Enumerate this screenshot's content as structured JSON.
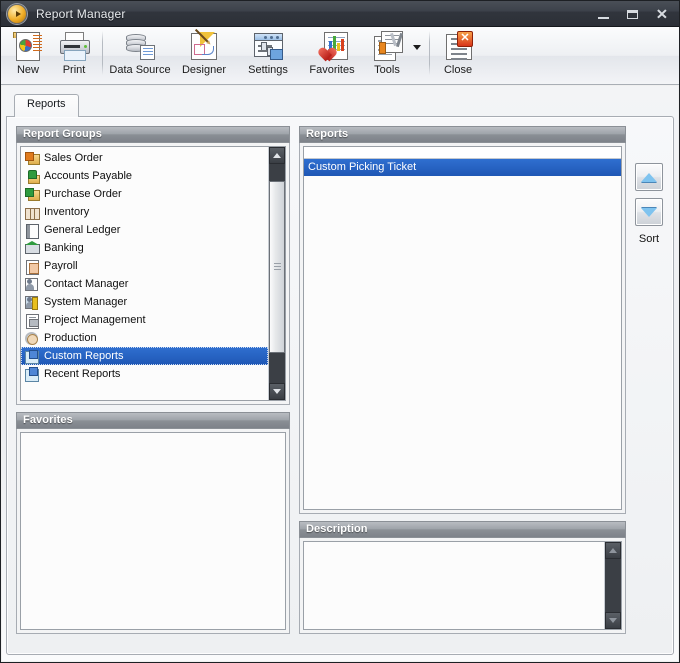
{
  "window": {
    "title": "Report Manager",
    "logo_icon": "play-circle-icon",
    "minimize_label": "–",
    "maximize_label": "□",
    "close_label": "✕"
  },
  "toolbar": {
    "items": [
      {
        "label": "New",
        "icon": "new-report-icon"
      },
      {
        "label": "Print",
        "icon": "printer-icon"
      },
      {
        "label": "Data Source",
        "icon": "database-icon"
      },
      {
        "label": "Designer",
        "icon": "designer-pencil-icon"
      },
      {
        "label": "Settings",
        "icon": "settings-sliders-icon"
      },
      {
        "label": "Favorites",
        "icon": "favorites-heart-icon"
      },
      {
        "label": "Tools",
        "icon": "tools-wrench-icon"
      },
      {
        "label": "Close",
        "icon": "close-document-icon"
      }
    ],
    "overflow_icon": "chevron-down-icon"
  },
  "tabs": [
    {
      "label": "Reports",
      "selected": true
    }
  ],
  "report_groups": {
    "title": "Report Groups",
    "items": [
      {
        "label": "Sales Order",
        "icon": "sales-order-icon",
        "selected": false
      },
      {
        "label": "Accounts Payable",
        "icon": "accounts-payable-icon",
        "selected": false
      },
      {
        "label": "Purchase Order",
        "icon": "purchase-order-icon",
        "selected": false
      },
      {
        "label": "Inventory",
        "icon": "inventory-icon",
        "selected": false
      },
      {
        "label": "General Ledger",
        "icon": "general-ledger-icon",
        "selected": false
      },
      {
        "label": "Banking",
        "icon": "banking-icon",
        "selected": false
      },
      {
        "label": "Payroll",
        "icon": "payroll-icon",
        "selected": false
      },
      {
        "label": "Contact Manager",
        "icon": "contact-manager-icon",
        "selected": false
      },
      {
        "label": "System Manager",
        "icon": "system-manager-icon",
        "selected": false
      },
      {
        "label": "Project Management",
        "icon": "project-management-icon",
        "selected": false
      },
      {
        "label": "Production",
        "icon": "production-icon",
        "selected": false
      },
      {
        "label": "Custom Reports",
        "icon": "custom-reports-icon",
        "selected": true
      },
      {
        "label": "Recent Reports",
        "icon": "recent-reports-icon",
        "selected": false
      }
    ],
    "scrollbar": {
      "up_icon": "scroll-up-arrow-icon",
      "down_icon": "scroll-down-arrow-icon"
    }
  },
  "favorites": {
    "title": "Favorites",
    "items": []
  },
  "reports": {
    "title": "Reports",
    "items": [
      {
        "label": "Custom Picking Ticket",
        "selected": true
      }
    ]
  },
  "sort": {
    "label": "Sort",
    "up_icon": "sort-up-arrow-icon",
    "down_icon": "sort-down-arrow-icon"
  },
  "description": {
    "title": "Description",
    "text": "",
    "scrollbar": {
      "up_icon": "scroll-up-arrow-icon",
      "down_icon": "scroll-down-arrow-icon"
    }
  },
  "colors": {
    "selection_blue": "#1f57b5",
    "panel_header_gray": "#8b9096",
    "titlebar_dark": "#2c3037",
    "accent_orange": "#e8861f"
  }
}
